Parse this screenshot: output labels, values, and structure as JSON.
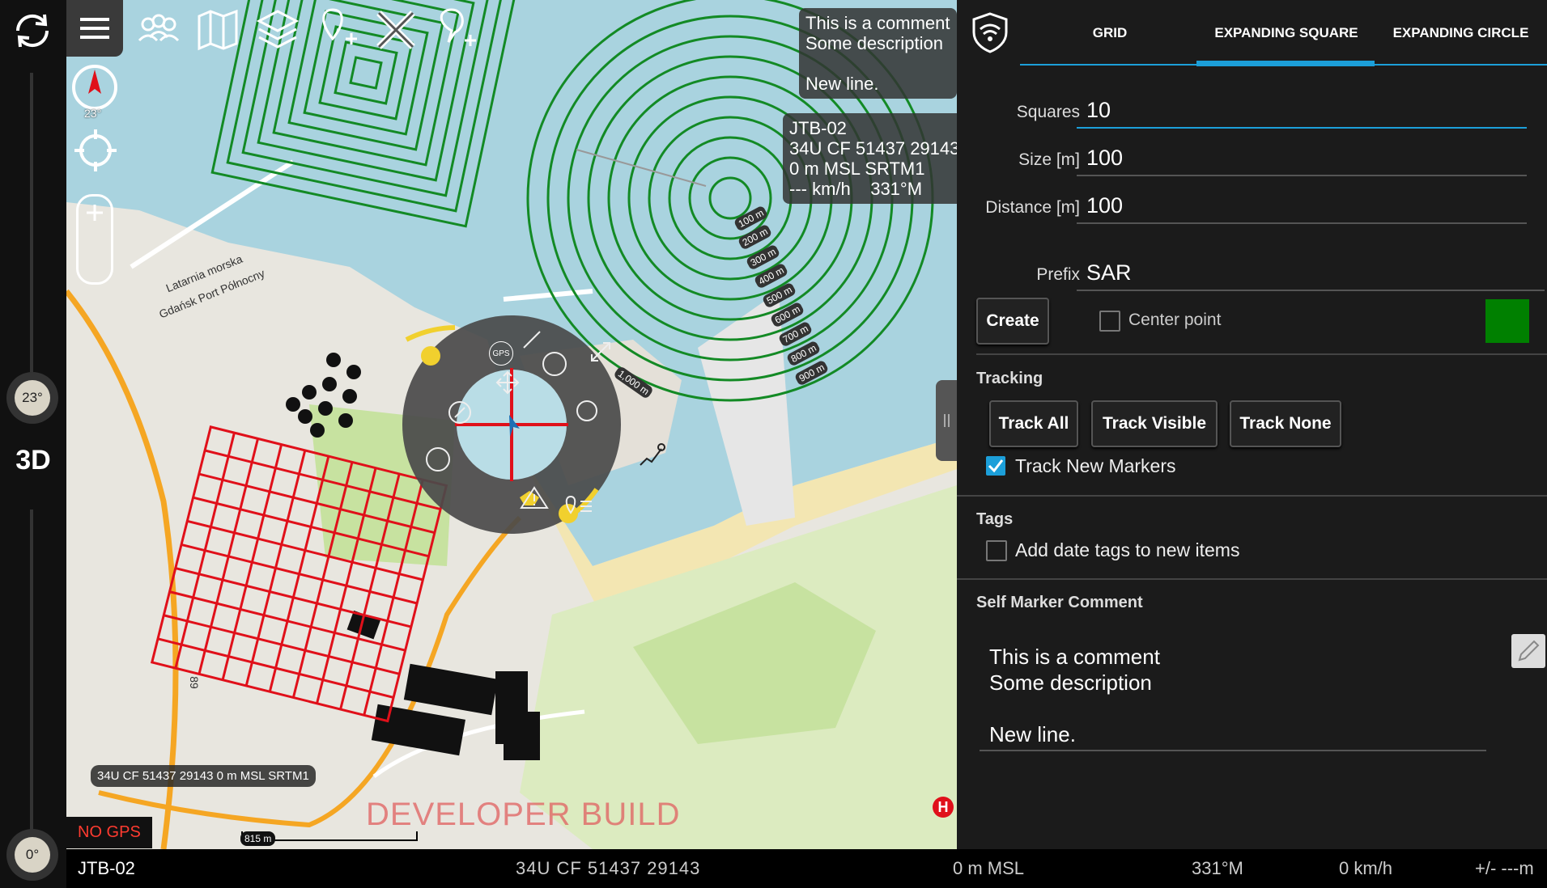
{
  "left_rail": {
    "refresh_icon": "refresh-icon",
    "tilt_label": "23°",
    "mode_label": "3D",
    "rotation_label": "0°"
  },
  "toolbar": {
    "icons": [
      "menu-icon",
      "contacts-icon",
      "map-icon",
      "layers-icon",
      "add-marker-icon",
      "tools-icon",
      "comment-marker-icon"
    ]
  },
  "map": {
    "compass_degrees": "23°",
    "comment_box": "This is a comment\nSome description\n\nNew line.",
    "self_info": "JTB-02\n34U CF 51437 29143\n0 m MSL SRTM1\n--- km/h    331°M",
    "ring_labels": [
      "100 m",
      "200 m",
      "300 m",
      "400 m",
      "500 m",
      "600 m",
      "700 m",
      "800 m",
      "900 m",
      "1,000 m"
    ],
    "coord_pill": "34U CF 51437 29143 0 m MSL SRTM1",
    "no_gps": "NO GPS",
    "dev_build": "DEVELOPER BUILD",
    "scale": "815 m",
    "place_label_1": "Latarnia morska",
    "place_label_2": "Gdańsk Port Północny",
    "radial_gps": "GPS",
    "road_number": "89",
    "hospital": "H"
  },
  "status_bar": {
    "callsign": "JTB-02",
    "mgrs": "34U  CF  51437  29143",
    "altitude": "0 m MSL",
    "heading": "331°M",
    "speed": "0 km/h",
    "accuracy": "+/- ---m"
  },
  "panel": {
    "tabs": [
      {
        "label": "GRID"
      },
      {
        "label": "EXPANDING SQUARE",
        "selected": true
      },
      {
        "label": "EXPANDING CIRCLE"
      }
    ],
    "fields": {
      "squares": {
        "label": "Squares",
        "value": "10"
      },
      "size": {
        "label": "Size [m]",
        "value": "100"
      },
      "distance": {
        "label": "Distance [m]",
        "value": "100"
      },
      "prefix": {
        "label": "Prefix",
        "value": "SAR"
      }
    },
    "create_label": "Create",
    "center_point_label": "Center point",
    "center_point_checked": false,
    "color_swatch": "#008000",
    "tracking": {
      "title": "Tracking",
      "buttons": [
        "Track All",
        "Track Visible",
        "Track None"
      ],
      "track_new_label": "Track New Markers",
      "track_new_checked": true
    },
    "tags": {
      "title": "Tags",
      "add_date_label": "Add date tags to new items",
      "add_date_checked": false
    },
    "self_marker": {
      "title": "Self Marker Comment",
      "comment_line1": "This is a comment",
      "comment_line2": "Some description",
      "comment_line3": "New line."
    }
  },
  "colors": {
    "accent": "#1c9fd9",
    "green_pattern": "#138a25",
    "red_grid": "#e0101a",
    "water": "#a9d3df"
  }
}
